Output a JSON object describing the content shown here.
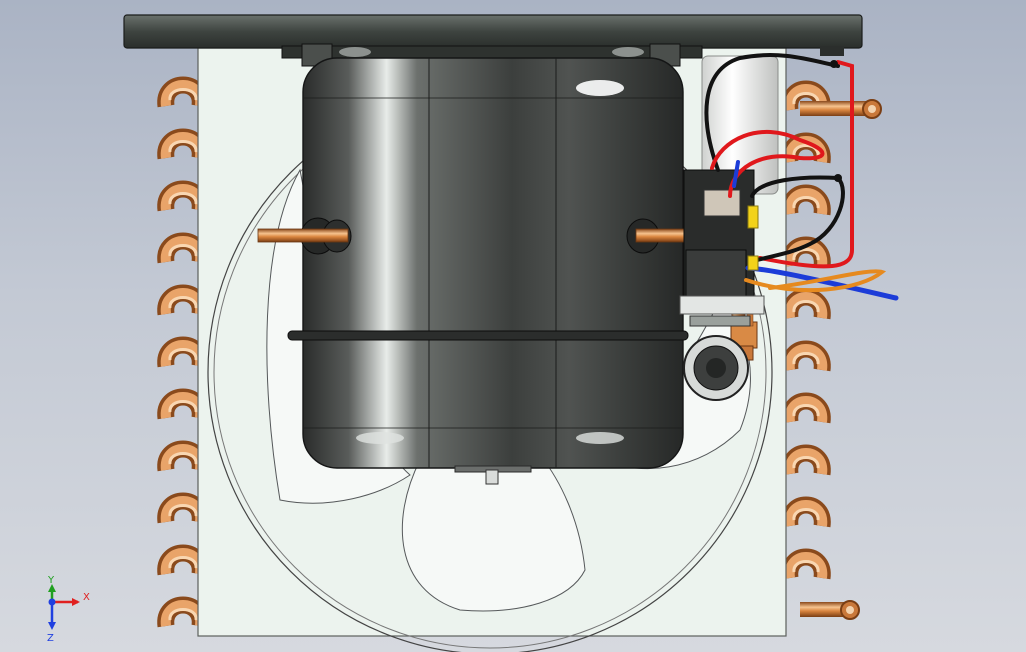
{
  "viewport": {
    "background_top": "#aab3c4",
    "background_bottom": "#d6d9df"
  },
  "model": {
    "subject": "condensing unit",
    "colors": {
      "top_plate": "#3e4440",
      "panel": "#ecf3ee",
      "compressor_body": "#4a4d4a",
      "copper": "#c9783a",
      "copper_highlight": "#f6c38e",
      "wire_red": "#e0181c",
      "wire_black": "#121212",
      "wire_blue": "#1c3cd8",
      "wire_orange": "#e68a1f",
      "wire_yellow": "#f2d21a",
      "capacitor": "#f1f1ef",
      "fan_blade_stroke": "#55585a"
    }
  },
  "triad": {
    "x_label": "X",
    "y_label": "Y",
    "z_label": "Z",
    "x_color": "#e02020",
    "y_color": "#20a020",
    "z_color": "#2040e0"
  }
}
